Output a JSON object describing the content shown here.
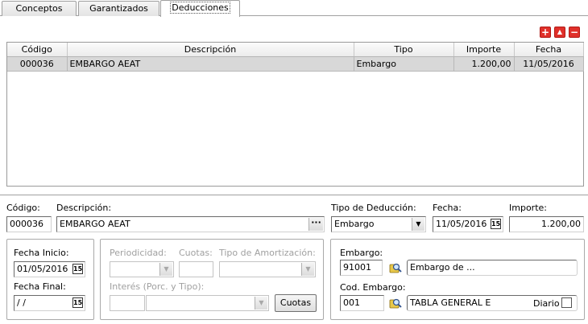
{
  "tabs": [
    {
      "label": "Conceptos"
    },
    {
      "label": "Garantizados"
    },
    {
      "label": "Deducciones"
    }
  ],
  "toolbar": {
    "add_symbol": "+",
    "up_symbol": "▲",
    "remove_symbol": "−",
    "accent": "#e0302a"
  },
  "grid": {
    "columns": [
      "Código",
      "Descripción",
      "Tipo",
      "Importe",
      "Fecha"
    ],
    "rows": [
      [
        "000036",
        "EMBARGO AEAT",
        "Embargo",
        "1.200,00",
        "11/05/2016"
      ]
    ]
  },
  "form": {
    "codigo_label": "Código:",
    "codigo_value": "000036",
    "descripcion_label": "Descripción:",
    "descripcion_value": "EMBARGO AEAT",
    "ellipsis": "···",
    "tipo_label": "Tipo de Deducción:",
    "tipo_value": "Embargo",
    "fecha_label": "Fecha:",
    "fecha_value": "11/05/2016",
    "importe_label": "Importe:",
    "importe_value": "1.200,00"
  },
  "fechas": {
    "inicio_label": "Fecha Inicio:",
    "inicio_value": "01/05/2016",
    "final_label": "Fecha Final:",
    "final_value": " / /"
  },
  "periodicidad": {
    "periodicidad_label": "Periodicidad:",
    "cuotas_label": "Cuotas:",
    "tipo_amort_label": "Tipo de Amortización:",
    "interes_label": "Interés (Porc. y Tipo):",
    "cuotas_button": "Cuotas"
  },
  "embargo": {
    "embargo_label": "Embargo:",
    "embargo_code": "91001",
    "embargo_desc": "Embargo de ...",
    "cod_label": "Cod. Embargo:",
    "cod_value": "001",
    "tabla_value": "TABLA GENERAL E",
    "diario_label": "Diario"
  },
  "icons": {
    "calendar": "15",
    "dropdown": "▼"
  }
}
